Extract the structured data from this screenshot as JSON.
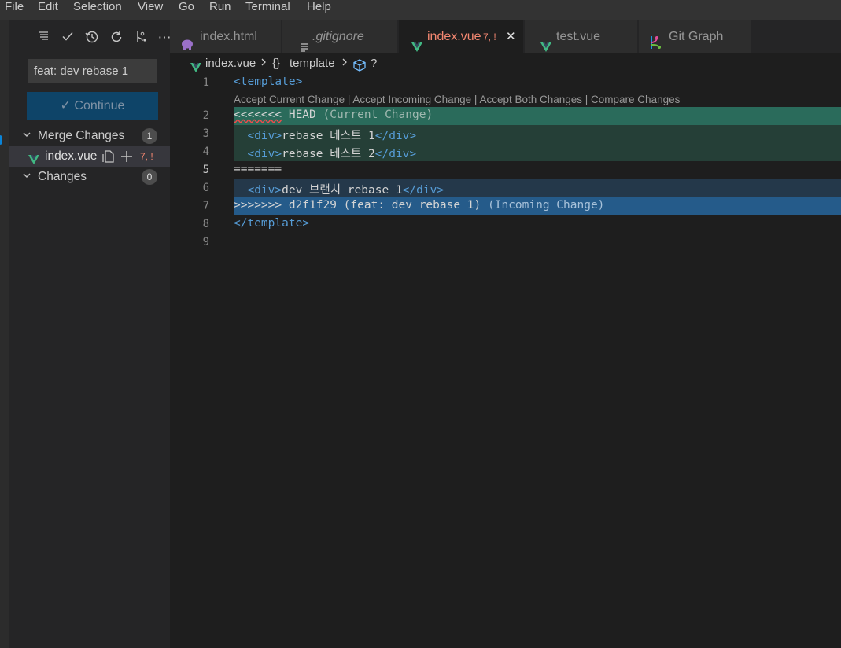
{
  "menu": [
    "File",
    "Edit",
    "Selection",
    "View",
    "Go",
    "Run",
    "Terminal",
    "Help"
  ],
  "sidebar": {
    "commit_message": "feat: dev rebase 1",
    "continue_label": "Continue",
    "merge_changes": {
      "label": "Merge Changes",
      "count": "1"
    },
    "file": {
      "name": "index.vue",
      "status": "7, !"
    },
    "changes": {
      "label": "Changes",
      "count": "0"
    },
    "toolbar_icons": [
      "list-tree-icon",
      "check-icon",
      "history-icon",
      "refresh-icon",
      "branch-graph-icon",
      "more-icon"
    ]
  },
  "tabs": [
    {
      "label": "index.html",
      "icon": "elephant-icon"
    },
    {
      "label": ".gitignore",
      "icon": "lines-icon"
    },
    {
      "label": "index.vue",
      "status": "7, !",
      "close": "✕",
      "icon": "vue-icon"
    },
    {
      "label": "test.vue",
      "icon": "vue-icon"
    },
    {
      "label": "Git Graph",
      "icon": "git-graph-icon"
    }
  ],
  "breadcrumb": {
    "file": "index.vue",
    "braces": "{}",
    "section": "template",
    "unknown": "?"
  },
  "codelens": "Accept Current Change | Accept Incoming Change | Accept Both Changes | Compare Changes",
  "lines": {
    "n1": "1",
    "n2": "2",
    "n3": "3",
    "n4": "4",
    "n5": "5",
    "n6": "6",
    "n7": "7",
    "n8": "8",
    "n9": "9",
    "l2_marker": "<<<<<<<",
    "l2_head": " HEAD",
    "l2_note": " (Current Change)",
    "l3_text": "rebase 테스트 1",
    "l4_text": "rebase 테스트 2",
    "l5_text": "=======",
    "l6_text": "dev 브랜치 rebase 1",
    "l7_marker": ">>>>>>>",
    "l7_commit": " d2f1f29 (feat: dev rebase 1)",
    "l7_note": " (Incoming Change)",
    "tag_open": "<",
    "tag_close_open": "</",
    "tag_end": ">",
    "template": "template",
    "div": "div"
  },
  "colors": {
    "current_header": "#2a6b5b",
    "current_body": "#253f37",
    "incoming_header": "#255b8a",
    "incoming_body": "#24384a",
    "accent_modified": "#f48771",
    "vue_green": "#41b883"
  }
}
